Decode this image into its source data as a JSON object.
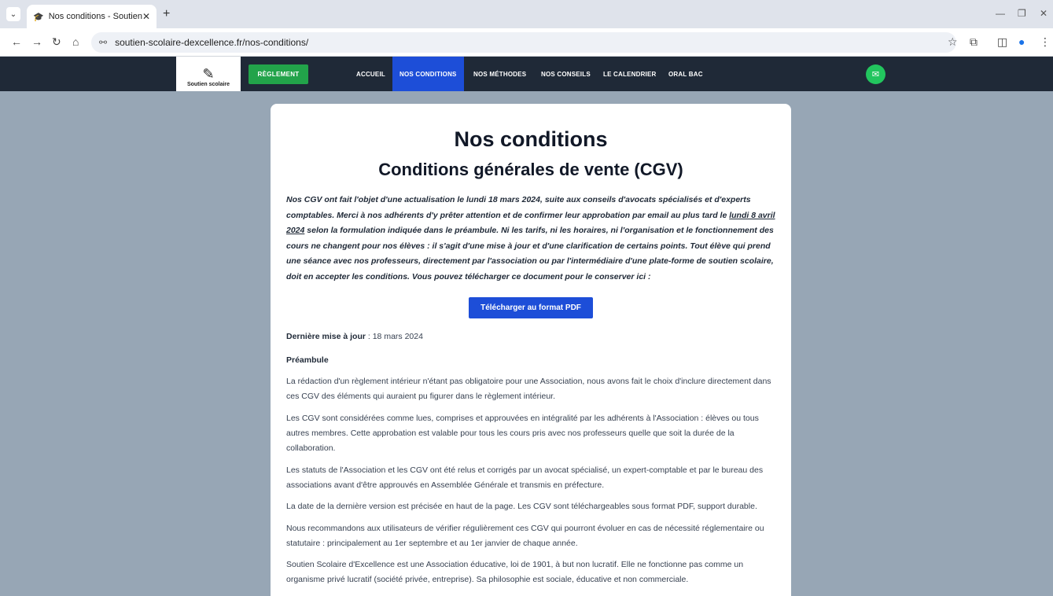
{
  "browser": {
    "tab_title": "Nos conditions - Soutien scolai",
    "url": "soutien-scolaire-dexcellence.fr/nos-conditions/"
  },
  "site": {
    "logo_text": "Soutien scolaire",
    "reglement_button": "RÈGLEMENT",
    "menu": [
      {
        "label": "ACCUEIL"
      },
      {
        "label": "NOS CONDITIONS"
      },
      {
        "label": "NOS MÉTHODES"
      },
      {
        "label": "NOS CONSEILS"
      },
      {
        "label": "LE CALENDRIER"
      },
      {
        "label": "ORAL BAC"
      }
    ],
    "colors": {
      "nav_bg": "#1f2937",
      "active": "#1d4ed8",
      "green": "#22a34a"
    }
  },
  "page": {
    "title": "Nos conditions",
    "subtitle": "Conditions générales de vente (CGV)",
    "intro_before_link": "Nos CGV ont fait l'objet d'une actualisation le lundi 18 mars 2024, suite aux conseils d'avocats spécialisés et d'experts comptables. Merci à nos adhérents d'y prêter attention et de confirmer leur approbation par email au plus tard le ",
    "intro_link": "lundi 8 avril 2024",
    "intro_after_link": " selon la formulation indiquée dans le préambule. Ni les tarifs, ni les horaires, ni l'organisation et le fonctionnement des cours ne changent pour nos élèves : il s'agit d'une mise à jour et d'une clarification de certains points. Tout élève qui prend une séance avec nos professeurs, directement par l'association ou par l'intermédiaire d'une plate-forme de soutien scolaire, doit en accepter les conditions. Vous pouvez télécharger ce document pour le conserver ici :",
    "pdf_button": "Télécharger au format PDF",
    "update_label": "Dernière mise à jour",
    "update_value": " : 18 mars 2024",
    "preamble_heading": "Préambule",
    "paragraphs": [
      "La rédaction d'un règlement intérieur n'étant pas obligatoire pour une Association, nous avons fait le choix d'inclure directement dans ces CGV des éléments qui auraient pu figurer dans le règlement intérieur.",
      "Les CGV sont considérées comme lues, comprises et approuvées en intégralité par les adhérents à l'Association : élèves ou tous autres membres. Cette approbation est valable pour tous les cours pris avec nos professeurs quelle que soit la durée de la collaboration.",
      "Les statuts de l'Association et les CGV ont été relus et corrigés par un avocat spécialisé, un expert-comptable et par le bureau des associations avant d'être approuvés en Assemblée Générale et transmis en préfecture.",
      "La date de la dernière version est précisée en haut de la page. Les CGV sont téléchargeables sous format PDF, support durable.",
      "Nous recommandons aux utilisateurs de vérifier régulièrement ces CGV qui pourront évoluer en cas de nécessité réglementaire ou statutaire : principalement au 1er septembre et au 1er janvier de chaque année.",
      "Soutien Scolaire d'Excellence est une Association éducative, loi de 1901, à but non lucratif. Elle ne fonctionne pas comme un organisme privé lucratif (société privée, entreprise). Sa philosophie est sociale, éducative et non commerciale."
    ]
  }
}
